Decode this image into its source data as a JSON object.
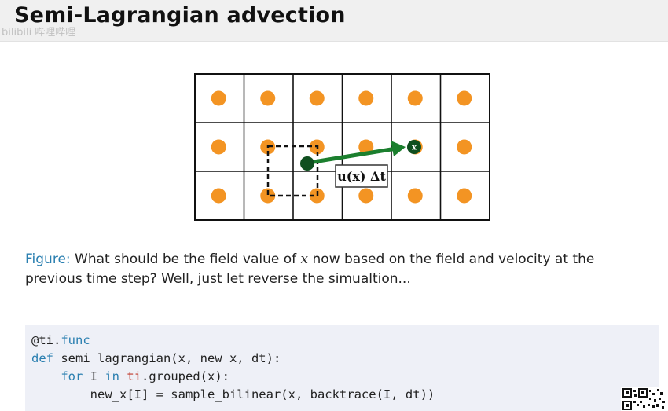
{
  "slide": {
    "title": "Semi-Lagrangian advection",
    "watermark": "bilibili 哔哩哔哩"
  },
  "figure": {
    "grid": {
      "rows": 3,
      "cols": 6
    },
    "colors": {
      "dot": "#f39423",
      "green": "#1b7f2e",
      "dark_green": "#0f4f1f",
      "line": "#111111"
    },
    "x_marker": "x",
    "label": "u(x) Δt"
  },
  "caption": {
    "label": "Figure:",
    "text_before": " What should be the field value of ",
    "math": "x",
    "text_after": " now based on the field and velocity at the previous time step? Well, just let reverse the simualtion..."
  },
  "code": {
    "line1": {
      "decorator": "@ti.",
      "func": "func"
    },
    "line2": {
      "def": "def",
      "rest": " semi_lagrangian(x, new_x, dt):"
    },
    "line3": {
      "indent": "    ",
      "for": "for",
      "mid": " I ",
      "in": "in",
      "sp": " ",
      "ti": "ti",
      "rest": ".grouped(x):"
    },
    "line4": {
      "text": "        new_x[I] = sample_bilinear(x, backtrace(I, dt))"
    }
  }
}
